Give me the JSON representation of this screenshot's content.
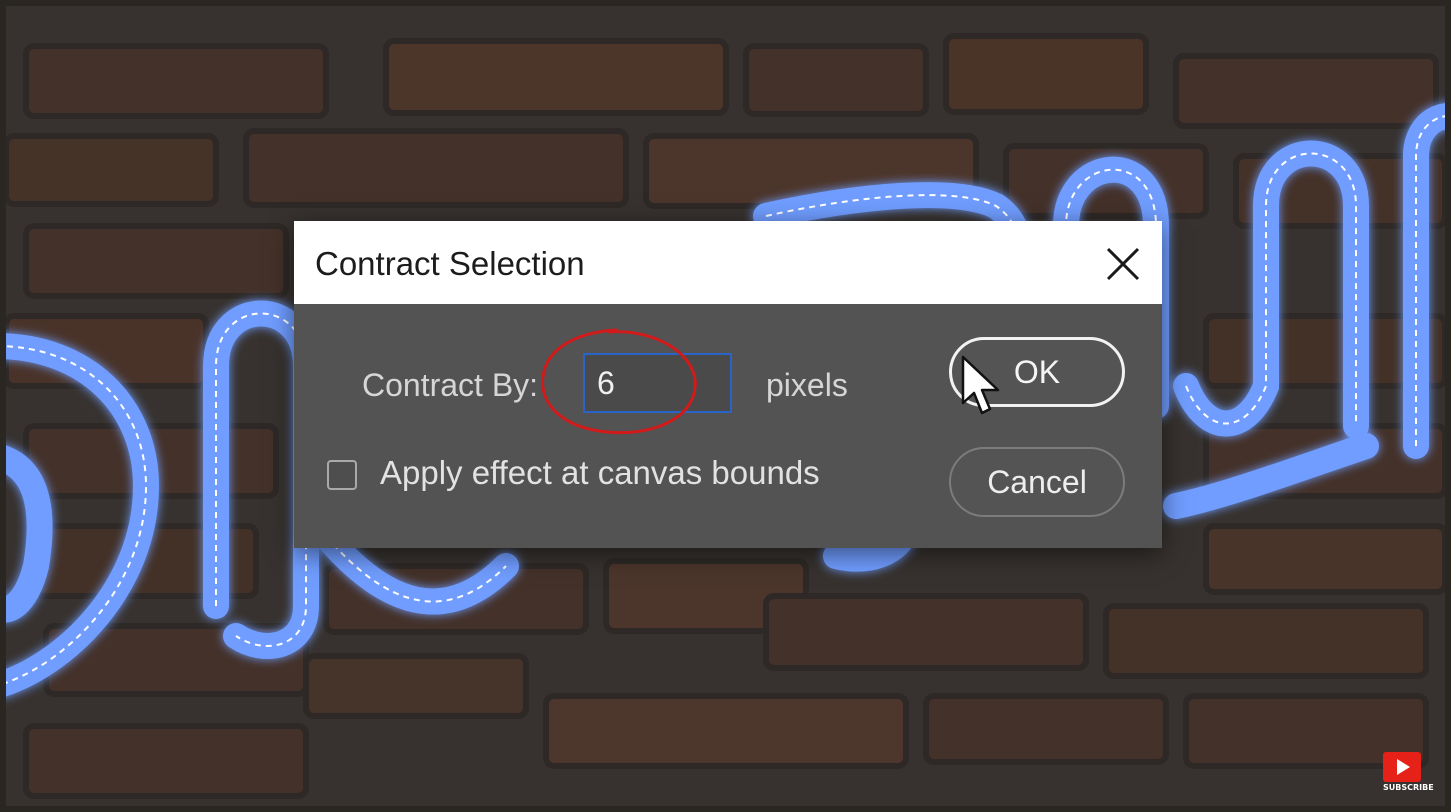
{
  "dialog": {
    "title": "Contract Selection",
    "contract_label": "Contract By:",
    "contract_value": "6",
    "units": "pixels",
    "checkbox_label": "Apply effect at canvas bounds",
    "checkbox_checked": false,
    "ok_label": "OK",
    "cancel_label": "Cancel",
    "close_icon": "close-icon"
  },
  "overlay": {
    "annotation": "red-circle-highlight",
    "cursor_icon": "arrow-cursor-icon",
    "subscribe_label": "SUBSCRIBE"
  },
  "colors": {
    "dialog_body": "#535353",
    "titlebar": "#ffffff",
    "input_border": "#2a64c8",
    "annotation": "#d21a1a",
    "neon": "#6f9dff",
    "youtube_red": "#e62117"
  }
}
